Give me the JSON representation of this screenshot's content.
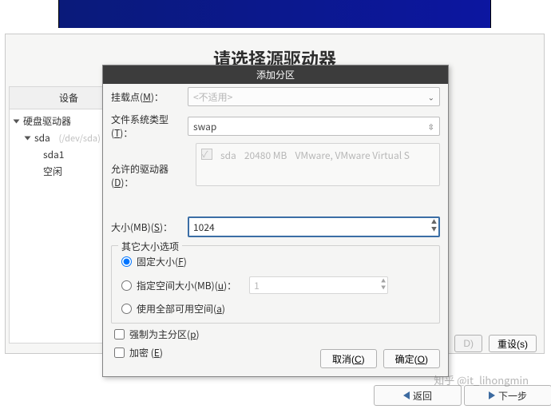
{
  "banner": {},
  "bg": {
    "title": "请选择源驱动器",
    "tree_header": "设备",
    "tree": {
      "root": "硬盘驱动器",
      "dev": "sda",
      "dev_dim": "(/dev/sda)",
      "part1": "sda1",
      "free": "空闲"
    },
    "buttons": {
      "d": "D)",
      "reset": "重设(s)"
    }
  },
  "dialog": {
    "title": "添加分区",
    "mount_lbl_pre": "挂载点(",
    "mount_lbl_key": "M",
    "mount_lbl_post": ")：",
    "mount_value": "<不适用>",
    "fs_lbl_pre": "文件系统类型(",
    "fs_lbl_key": "T",
    "fs_lbl_post": ")：",
    "fs_value": "swap",
    "drv_lbl_pre": "允许的驱动器(",
    "drv_lbl_key": "D",
    "drv_lbl_post": ")：",
    "drv_name": "sda",
    "drv_size": "20480 MB",
    "drv_desc": "VMware, VMware Virtual S",
    "size_lbl_pre": "大小(MB)(",
    "size_lbl_key": "S",
    "size_lbl_post": ")：",
    "size_value": "1024",
    "other_legend": "其它大小选项",
    "radio_fixed_pre": "固定大小(",
    "radio_fixed_key": "F",
    "radio_fixed_post": ")",
    "radio_upto_pre": "指定空间大小(MB)(",
    "radio_upto_key": "u",
    "radio_upto_post": ")：",
    "radio_upto_val": "1",
    "radio_all_pre": "使用全部可用空间(",
    "radio_all_key": "a",
    "radio_all_post": ")",
    "cb_primary_pre": "强制为主分区(",
    "cb_primary_key": "p",
    "cb_primary_post": ")",
    "cb_encrypt_pre": "加密 (",
    "cb_encrypt_key": "E",
    "cb_encrypt_post": ")",
    "btn_cancel_pre": "取消(",
    "btn_cancel_key": "C",
    "btn_cancel_post": ")",
    "btn_ok_pre": "确定(",
    "btn_ok_key": "O",
    "btn_ok_post": ")"
  },
  "nav": {
    "back": "返回",
    "next": "下一步"
  },
  "watermark": "知乎 @it_lihongmin"
}
